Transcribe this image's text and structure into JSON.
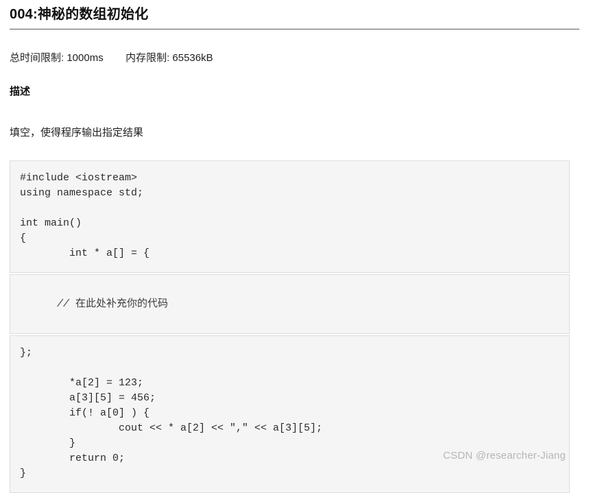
{
  "problem": {
    "title": "004:神秘的数组初始化",
    "time_limit_label": "总时间限制:",
    "time_limit_value": "1000ms",
    "memory_limit_label": "内存限制:",
    "memory_limit_value": "65536kB",
    "description_heading": "描述",
    "description_text": "填空，使得程序输出指定结果"
  },
  "code": {
    "top": "#include <iostream>\nusing namespace std;\n\nint main()\n{\n        int * a[] = {",
    "blank_slashes": "//",
    "blank_comment_text": "在此处补充你的代码",
    "bottom": "};\n\n        *a[2] = 123;\n        a[3][5] = 456;\n        if(! a[0] ) {\n                cout << * a[2] << \",\" << a[3][5];\n        }\n        return 0;\n}"
  },
  "watermark": {
    "text": "CSDN @researcher-Jiang"
  },
  "colors": {
    "page_background": "#ffffff",
    "code_background": "#f5f5f5",
    "code_border": "#dcdcdc",
    "title_rule": "#555a5f",
    "text": "#1f1f1f",
    "watermark": "#b5b5b5"
  }
}
